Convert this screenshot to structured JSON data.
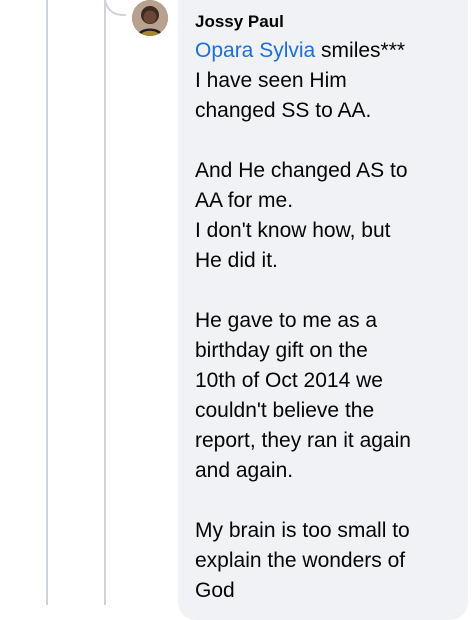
{
  "comment": {
    "author": "Jossy Paul",
    "mention": "Opara Sylvia",
    "text": " smiles***\nI have seen Him\nchanged SS to AA.\n\nAnd He changed AS to\nAA for me.\nI don't know how, but\nHe did it.\n\nHe gave to me as a\nbirthday gift on the\n10th of Oct 2014 we\ncouldn't believe the\nreport, they ran it again\nand again.\n\nMy brain is too small to\nexplain the wonders of\nGod"
  },
  "colors": {
    "bubble": "#f0f2f5",
    "mention": "#1b6fd6",
    "thread_line": "#d0d3d9"
  },
  "icons": {
    "avatar": "profile-photo"
  }
}
